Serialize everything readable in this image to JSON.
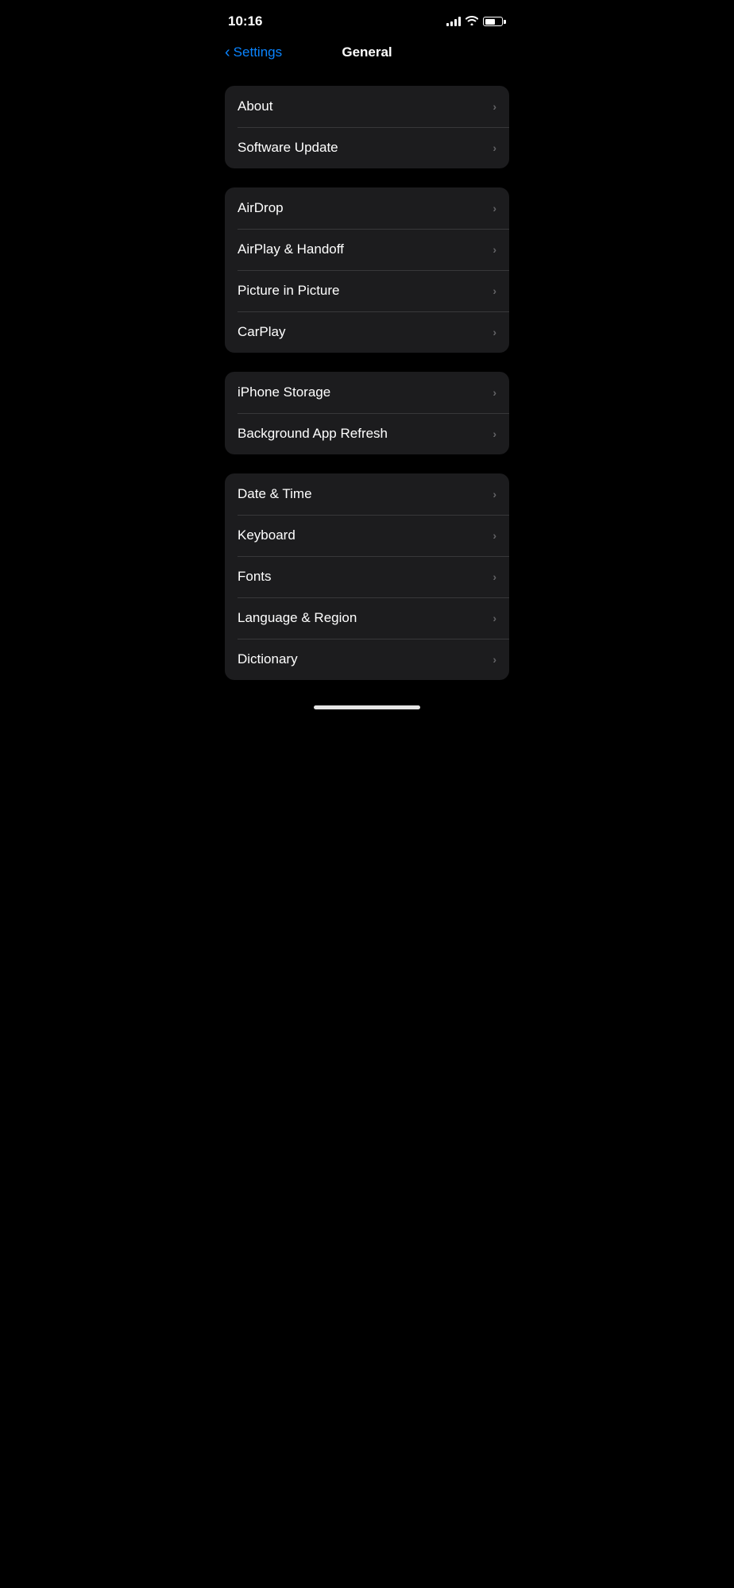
{
  "statusBar": {
    "time": "10:16",
    "batteryLevel": 60
  },
  "navBar": {
    "backLabel": "Settings",
    "title": "General"
  },
  "sections": [
    {
      "id": "section-1",
      "items": [
        {
          "id": "about",
          "label": "About"
        },
        {
          "id": "software-update",
          "label": "Software Update"
        }
      ]
    },
    {
      "id": "section-2",
      "items": [
        {
          "id": "airdrop",
          "label": "AirDrop"
        },
        {
          "id": "airplay-handoff",
          "label": "AirPlay & Handoff"
        },
        {
          "id": "picture-in-picture",
          "label": "Picture in Picture"
        },
        {
          "id": "carplay",
          "label": "CarPlay"
        }
      ]
    },
    {
      "id": "section-3",
      "items": [
        {
          "id": "iphone-storage",
          "label": "iPhone Storage"
        },
        {
          "id": "background-app-refresh",
          "label": "Background App Refresh"
        }
      ]
    },
    {
      "id": "section-4",
      "items": [
        {
          "id": "date-time",
          "label": "Date & Time"
        },
        {
          "id": "keyboard",
          "label": "Keyboard"
        },
        {
          "id": "fonts",
          "label": "Fonts"
        },
        {
          "id": "language-region",
          "label": "Language & Region"
        },
        {
          "id": "dictionary",
          "label": "Dictionary"
        }
      ]
    }
  ],
  "icons": {
    "chevronRight": "›",
    "backChevron": "‹"
  }
}
